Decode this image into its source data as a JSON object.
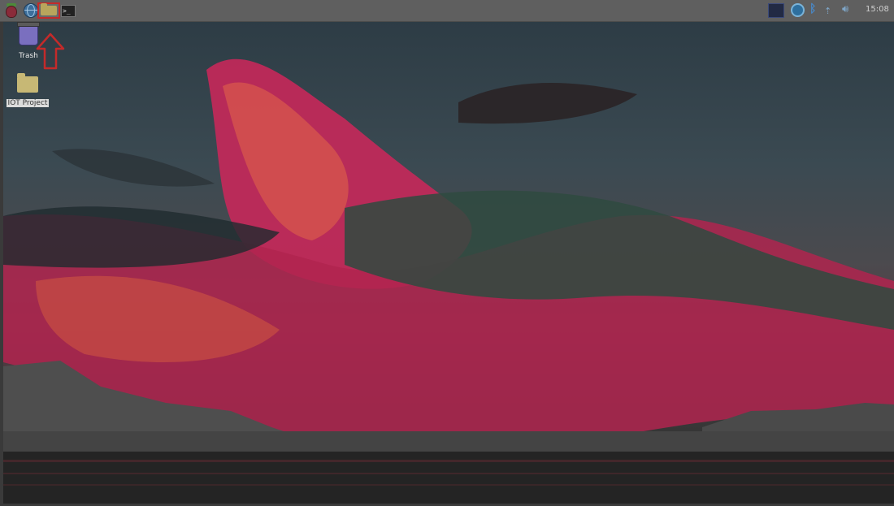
{
  "taskbar": {
    "launchers": [
      {
        "name": "raspberry-menu-icon"
      },
      {
        "name": "web-browser-icon"
      },
      {
        "name": "file-manager-icon"
      },
      {
        "name": "terminal-icon",
        "glyph": ">_"
      }
    ],
    "tray": {
      "clock": "15:08"
    }
  },
  "desktop": {
    "icons": [
      {
        "label": "Trash"
      },
      {
        "label": "IOT Project"
      }
    ]
  },
  "annotation": {
    "highlight_color": "#c42a2a"
  }
}
